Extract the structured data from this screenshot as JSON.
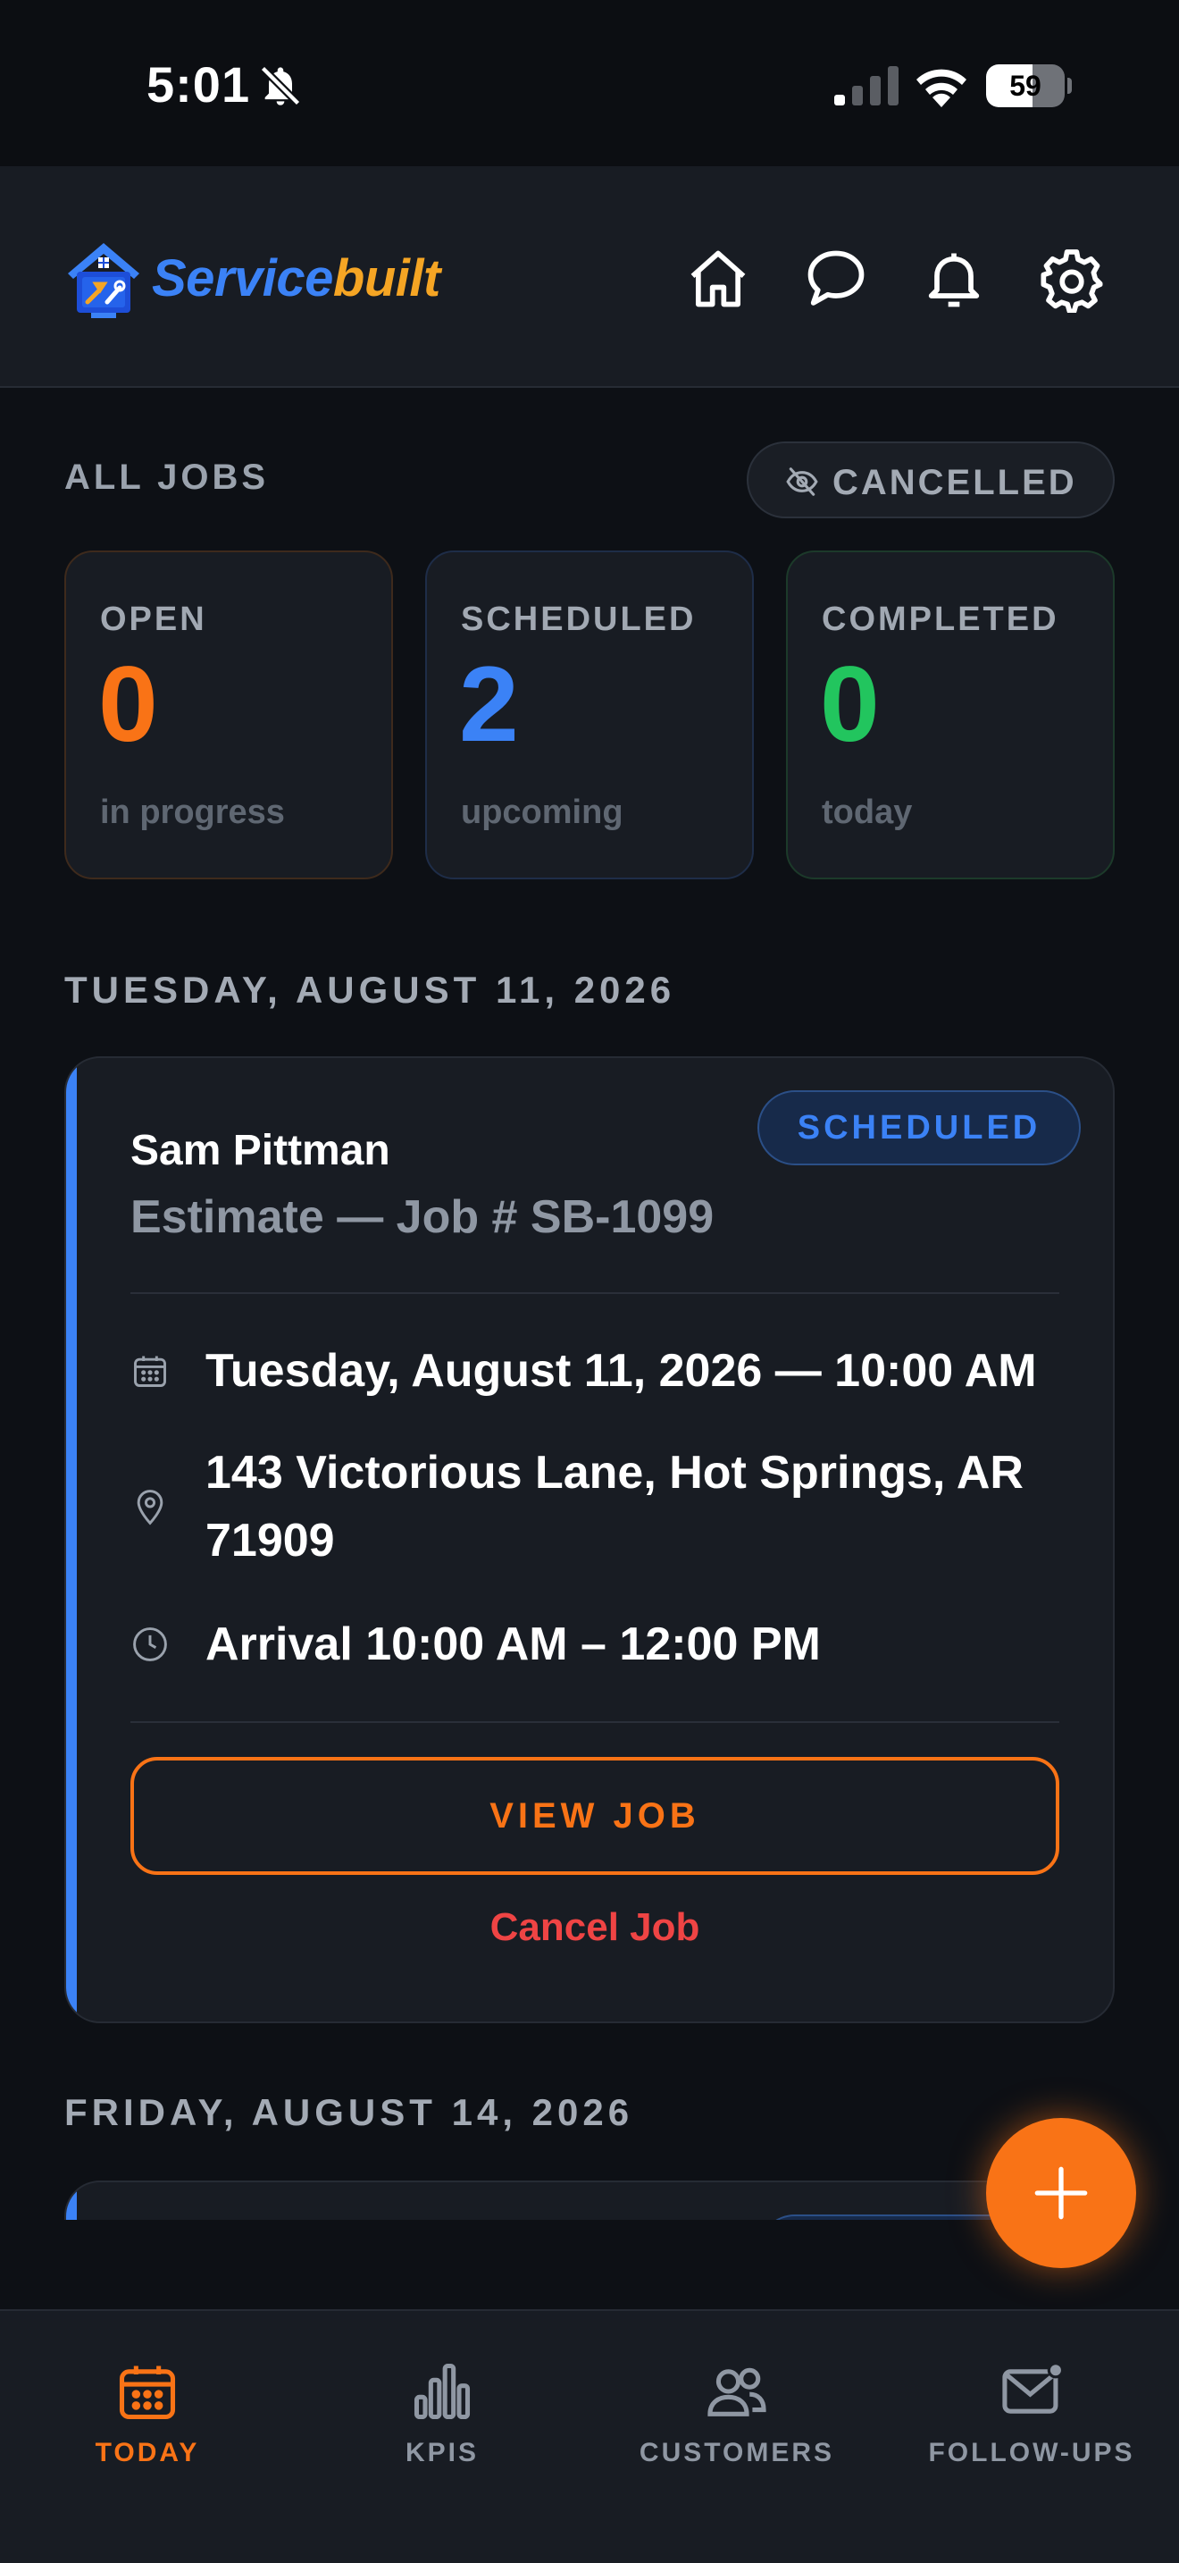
{
  "status_bar": {
    "time": "5:01",
    "battery": "59",
    "battery_level": 0.59,
    "icons": [
      "bell-slash-icon",
      "signal-icon",
      "wifi-icon",
      "battery-icon"
    ]
  },
  "header": {
    "logo_part1": "Service",
    "logo_part2": "built",
    "icons": [
      "home-icon",
      "chat-icon",
      "bell-icon",
      "gear-icon"
    ]
  },
  "jobs_section": {
    "title": "ALL JOBS",
    "cancelled_toggle": "CANCELLED"
  },
  "stats": [
    {
      "label": "OPEN",
      "value": "0",
      "sub": "in progress",
      "color": "#f97316"
    },
    {
      "label": "SCHEDULED",
      "value": "2",
      "sub": "upcoming",
      "color": "#3b82f6"
    },
    {
      "label": "COMPLETED",
      "value": "0",
      "sub": "today",
      "color": "#22c55e"
    }
  ],
  "groups": [
    {
      "date": "TUESDAY, AUGUST 11, 2026",
      "job": {
        "status": "SCHEDULED",
        "customer": "Sam Pittman",
        "title": "Estimate — Job # SB-1099",
        "datetime": "Tuesday, August 11, 2026 — 10:00 AM",
        "address_line1": "143 Victorious Lane, Hot Springs, AR",
        "address_line2": "71909",
        "arrival": "Arrival 10:00 AM – 12:00 PM",
        "view_label": "VIEW JOB",
        "cancel_label": "Cancel Job"
      }
    },
    {
      "date": "FRIDAY, AUGUST 14, 2026"
    }
  ],
  "fab_icon": "plus-icon",
  "bottom_nav": [
    {
      "label": "TODAY",
      "icon": "calendar-icon",
      "active": true
    },
    {
      "label": "KPIS",
      "icon": "bar-chart-icon",
      "active": false
    },
    {
      "label": "CUSTOMERS",
      "icon": "users-icon",
      "active": false
    },
    {
      "label": "FOLLOW-UPS",
      "icon": "mail-icon",
      "active": false
    }
  ],
  "colors": {
    "accent_orange": "#f97316",
    "accent_blue": "#3b82f6",
    "accent_green": "#22c55e",
    "danger_red": "#ef4444",
    "logo_gold": "#f5a524"
  }
}
